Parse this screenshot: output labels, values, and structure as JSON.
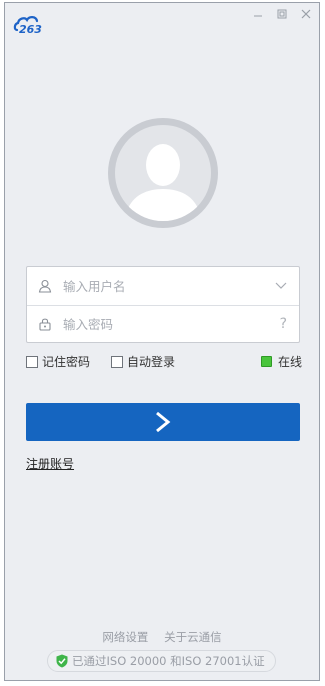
{
  "app": {
    "logo_text": "263"
  },
  "window_controls": {
    "minimize": "minimize",
    "maximize": "maximize",
    "close": "close"
  },
  "login": {
    "username_placeholder": "输入用户名",
    "password_placeholder": "输入密码",
    "password_help": "?"
  },
  "options": {
    "remember_password": "记住密码",
    "auto_login": "自动登录",
    "status": "在线",
    "status_color": "#49c53c"
  },
  "buttons": {
    "accent": "#1565c0",
    "register": "注册账号"
  },
  "footer": {
    "network_settings": "网络设置",
    "about": "关于云通信",
    "certification": "已通过ISO 20000 和ISO 27001认证"
  },
  "icons": [
    "logo-cloud-icon",
    "minimize-icon",
    "maximize-icon",
    "close-icon",
    "user-icon",
    "lock-icon",
    "chevron-down-icon",
    "help-icon",
    "arrow-right-icon",
    "shield-check-icon"
  ]
}
